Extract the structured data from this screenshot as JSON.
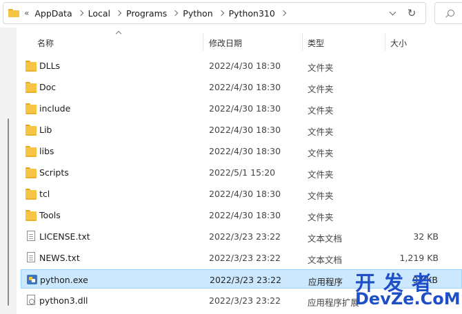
{
  "address_bar": {
    "overflow": "«",
    "crumbs": [
      "AppData",
      "Local",
      "Programs",
      "Python",
      "Python310"
    ]
  },
  "columns": {
    "name": "名称",
    "date": "修改日期",
    "type": "类型",
    "size": "大小"
  },
  "files": [
    {
      "name": "DLLs",
      "date": "2022/4/30 18:30",
      "type": "文件夹",
      "size": "",
      "icon": "folder-icon",
      "selected": false
    },
    {
      "name": "Doc",
      "date": "2022/4/30 18:30",
      "type": "文件夹",
      "size": "",
      "icon": "folder-icon",
      "selected": false
    },
    {
      "name": "include",
      "date": "2022/4/30 18:30",
      "type": "文件夹",
      "size": "",
      "icon": "folder-icon",
      "selected": false
    },
    {
      "name": "Lib",
      "date": "2022/4/30 18:30",
      "type": "文件夹",
      "size": "",
      "icon": "folder-icon",
      "selected": false
    },
    {
      "name": "libs",
      "date": "2022/4/30 18:30",
      "type": "文件夹",
      "size": "",
      "icon": "folder-icon",
      "selected": false
    },
    {
      "name": "Scripts",
      "date": "2022/5/1 15:20",
      "type": "文件夹",
      "size": "",
      "icon": "folder-icon",
      "selected": false
    },
    {
      "name": "tcl",
      "date": "2022/4/30 18:30",
      "type": "文件夹",
      "size": "",
      "icon": "folder-icon",
      "selected": false
    },
    {
      "name": "Tools",
      "date": "2022/4/30 18:30",
      "type": "文件夹",
      "size": "",
      "icon": "folder-icon",
      "selected": false
    },
    {
      "name": "LICENSE.txt",
      "date": "2022/3/23 23:22",
      "type": "文本文档",
      "size": "32 KB",
      "icon": "text-file-icon",
      "selected": false
    },
    {
      "name": "NEWS.txt",
      "date": "2022/3/23 23:22",
      "type": "文本文档",
      "size": "1,219 KB",
      "icon": "text-file-icon",
      "selected": false
    },
    {
      "name": "python.exe",
      "date": "2022/3/23 23:22",
      "type": "应用程序",
      "size": "97 KB",
      "icon": "python-exe-icon",
      "selected": true
    },
    {
      "name": "python3.dll",
      "date": "2022/3/23 23:22",
      "type": "应用程序扩展",
      "size": "",
      "icon": "dll-file-icon",
      "selected": false
    }
  ],
  "watermark": {
    "line1": "开发者",
    "line2": "DevZe.CoM"
  },
  "colors": {
    "selection_bg": "#cce8ff",
    "selection_border": "#99d1ff",
    "folder": "#f6c544",
    "watermark": "#1f4fc7"
  }
}
